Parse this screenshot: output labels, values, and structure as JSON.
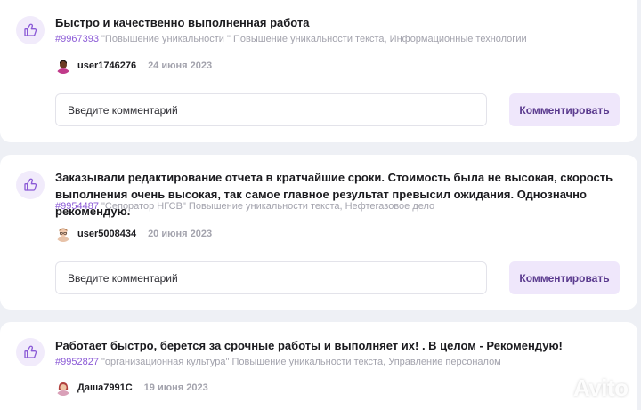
{
  "comment_placeholder": "Введите комментарий",
  "comment_button_label": "Комментировать",
  "reviews": [
    {
      "text": "Быстро и качественно выполненная работа",
      "order_id": "#9967393",
      "order_title": "\"Повышение уникальности \"",
      "category": "Повышение уникальности текста, Информационные технологии",
      "user": "user1746276",
      "date": "24 июня 2023",
      "avatar": "dark-skin-avatar"
    },
    {
      "text": "Заказывали редактирование отчета в кратчайшие сроки. Стоимость была не высокая, скорость выполнения очень высокая, так самое главное результат превысил ожидания. Однозначно рекомендую.",
      "order_id": "#9954487",
      "order_title": "\"Сепоратор НГСВ\"",
      "category": "Повышение уникальности текста, Нефтегазовое дело",
      "user": "user5008434",
      "date": "20 июня 2023",
      "avatar": "glasses-avatar"
    },
    {
      "text": "Работает быстро, берется за срочные работы и выполняет их! . В целом - Рекомендую!",
      "order_id": "#9952827",
      "order_title": "\"организационная культура\"",
      "category": "Повышение уникальности текста, Управление персоналом",
      "user": "Даша7991С",
      "date": "19 июня 2023",
      "avatar": "red-hair-avatar"
    }
  ],
  "watermark": "Avito",
  "colors": {
    "accent": "#8b5ad6",
    "button_bg": "#efe7fb",
    "page_bg": "#eef0f5"
  },
  "icons": {
    "like": "thumbs-up-icon"
  }
}
